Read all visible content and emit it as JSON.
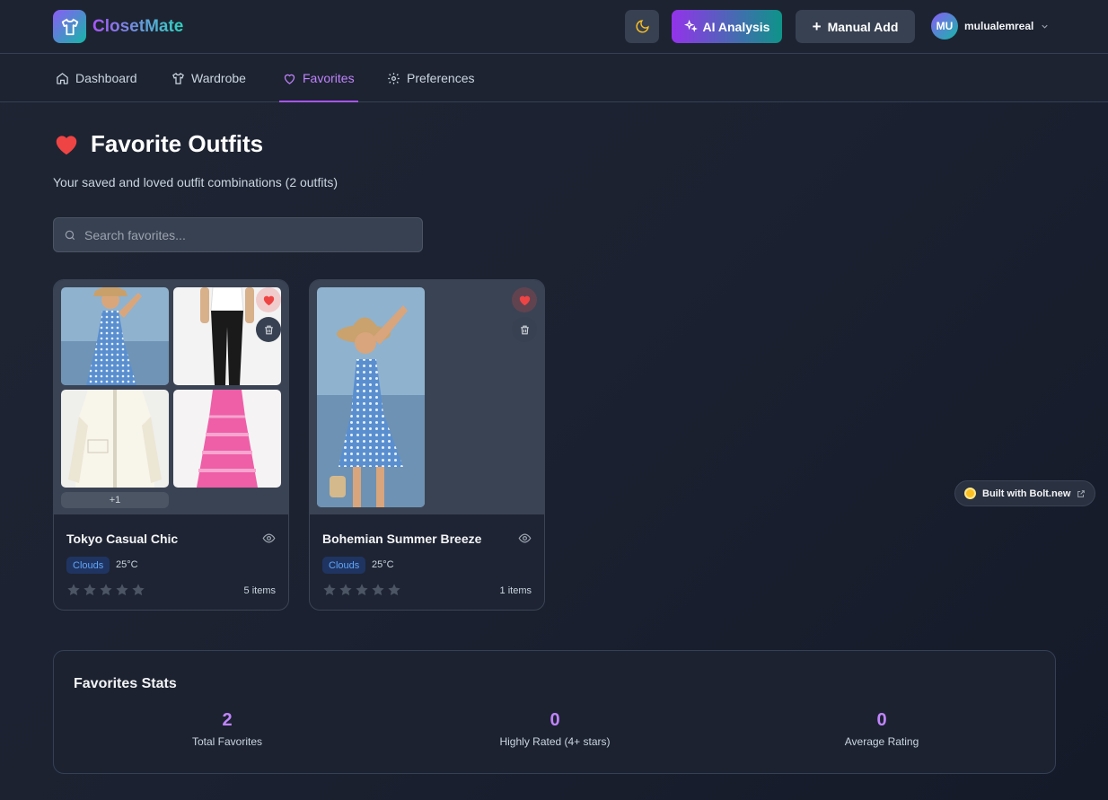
{
  "app": {
    "name": "ClosetMate",
    "icon": "shirt-icon",
    "brand_gradient": [
      "#8b5cf6",
      "#14b8a6"
    ]
  },
  "header": {
    "theme_toggle_icon": "moon-icon",
    "ai_button_label": "AI Analysis",
    "manual_add_label": "Manual Add",
    "user_initials": "MU",
    "username": "mulualemreal"
  },
  "nav": {
    "items": [
      {
        "label": "Dashboard",
        "icon": "home-icon",
        "active": false
      },
      {
        "label": "Wardrobe",
        "icon": "shirt-icon",
        "active": false
      },
      {
        "label": "Favorites",
        "icon": "heart-icon",
        "active": true
      },
      {
        "label": "Preferences",
        "icon": "gear-icon",
        "active": false
      }
    ],
    "active_color": "#a855f7"
  },
  "page": {
    "title": "Favorite Outfits",
    "subtitle": "Your saved and loved outfit combinations (2 outfits)",
    "search_placeholder": "Search favorites..."
  },
  "outfits": [
    {
      "name": "Tokyo Casual Chic",
      "weather": "Clouds",
      "temperature": "25°C",
      "rating": 0,
      "items_label": "5 items",
      "more_label": "+1",
      "thumbnails": [
        "blue-print-sundress",
        "white-top-black-trousers",
        "cream-jacket",
        "pink-ruffle-dress"
      ]
    },
    {
      "name": "Bohemian Summer Breeze",
      "weather": "Clouds",
      "temperature": "25°C",
      "rating": 0,
      "items_label": "1 items",
      "thumbnails": [
        "blue-print-sundress-straw-hat"
      ]
    }
  ],
  "stats": {
    "title": "Favorites Stats",
    "items": [
      {
        "value": "2",
        "label": "Total Favorites"
      },
      {
        "value": "0",
        "label": "Highly Rated (4+ stars)"
      },
      {
        "value": "0",
        "label": "Average Rating"
      }
    ],
    "value_color": "#c084fc"
  },
  "bolt_badge": {
    "label": "Built with Bolt.new"
  }
}
